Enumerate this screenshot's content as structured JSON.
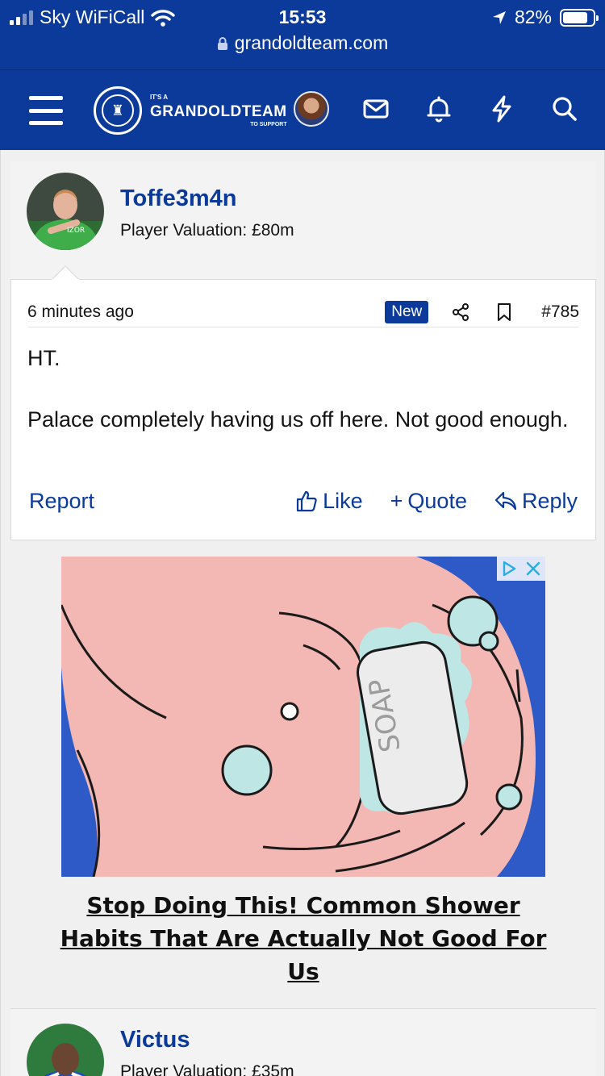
{
  "status_bar": {
    "carrier": "Sky WiFiCall",
    "time": "15:53",
    "battery": "82%",
    "battery_level": 0.82,
    "url": "grandoldteam.com"
  },
  "header": {
    "logo_top": "IT'S A",
    "logo_main": "GRANDOLDTEAM",
    "logo_bottom": "TO SUPPORT",
    "icons": [
      "menu-icon",
      "avatar",
      "mail-icon",
      "bell-icon",
      "lightning-icon",
      "search-icon"
    ]
  },
  "posts": [
    {
      "username": "Toffe3m4n",
      "valuation": "Player Valuation: £80m",
      "time_ago": "6 minutes ago",
      "badge": "New",
      "post_number": "#785",
      "paragraphs": [
        "HT.",
        "Palace completely having us off here. Not good enough."
      ],
      "report": "Report",
      "like": "Like",
      "quote": "Quote",
      "reply": "Reply"
    },
    {
      "username": "Victus",
      "valuation": "Player Valuation: £35m"
    }
  ],
  "ad": {
    "image_text": "SOAP",
    "headline": "Stop Doing This! Common Shower Habits That Are Actually Not Good For Us"
  },
  "colors": {
    "brand": "#0b3a9a",
    "ad_background": "#2d5ac7",
    "skin": "#f3b7b4",
    "bubble": "#bde6e4"
  }
}
